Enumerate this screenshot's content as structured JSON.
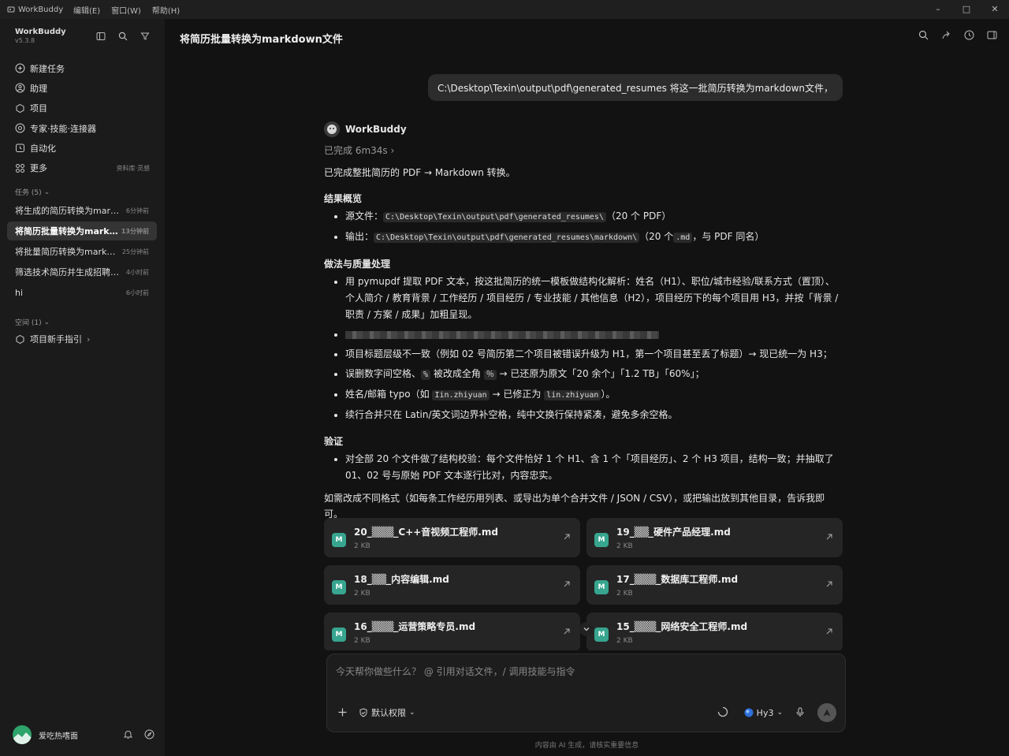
{
  "titlebar": {
    "app_name": "WorkBuddy",
    "menus": [
      "编辑(E)",
      "窗口(W)",
      "帮助(H)"
    ]
  },
  "sidebar": {
    "brand": "WorkBuddy",
    "version": "v5.3.8",
    "nav": [
      {
        "label": "新建任务",
        "icon": "new-task-icon"
      },
      {
        "label": "助理",
        "icon": "assistant-icon"
      },
      {
        "label": "项目",
        "icon": "project-icon"
      },
      {
        "label": "专家·技能·连接器",
        "icon": "expert-icon"
      },
      {
        "label": "自动化",
        "icon": "automation-icon"
      },
      {
        "label": "更多",
        "icon": "more-icon",
        "hint": "资料库·灵感"
      }
    ],
    "tasks_header": "任务 (5)",
    "tasks": [
      {
        "title": "将生成的简历转换为markdown",
        "time": "6分钟前"
      },
      {
        "title": "将简历批量转换为markdown文件",
        "time": "13分钟前",
        "active": true
      },
      {
        "title": "将批量简历转换为markdown",
        "time": "25分钟前"
      },
      {
        "title": "筛选技术简历并生成招聘报告",
        "time": "4小时前"
      },
      {
        "title": "hi",
        "time": "6小时前"
      }
    ],
    "spaces_header": "空间 (1)",
    "space_item": "项目新手指引",
    "user_name": "爱吃热嗜面"
  },
  "main": {
    "title": "将简历批量转换为markdown文件",
    "user_message": "C:\\Desktop\\Texin\\output\\pdf\\generated_resumes  将这一批简历转换为markdown文件，",
    "bot_name": "WorkBuddy",
    "done_text": "已完成 6m34s",
    "intro": "已完成整批简历的 PDF → Markdown 转换。",
    "sec1_title": "结果概览",
    "sec1_items": [
      {
        "pre": "源文件：",
        "code": "C:\\Desktop\\Texin\\output\\pdf\\generated_resumes\\",
        "post": "（20 个 PDF）"
      },
      {
        "pre": "输出：",
        "code": "C:\\Desktop\\Texin\\output\\pdf\\generated_resumes\\markdown\\",
        "post": "（20 个",
        "code2": ".md",
        "post2": "，与 PDF 同名）"
      }
    ],
    "sec2_title": "做法与质量处理",
    "sec2_item1": "用 pymupdf 提取 PDF 文本，按这批简历的统一模板做结构化解析：姓名（H1）、职位/城市经验/联系方式（置顶）、个人简介 / 教育背景 / 工作经历 / 项目经历 / 专业技能 / 其他信息（H2），项目经历下的每个项目用 H3，并按「背景 / 职责 / 方案 / 成果」加粗呈现。",
    "sec2_item3": "项目标题层级不一致（例如 02 号简历第二个项目被错误升级为 H1，第一个项目甚至丢了标题）→ 现已统一为 H3；",
    "sec2_item4_a": "误删数字间空格、",
    "sec2_item4_code1": "%",
    "sec2_item4_b": " 被改成全角 ",
    "sec2_item4_code2": "％",
    "sec2_item4_c": " → 已还原为原文「20 余个」「1.2 TB」「60%」；",
    "sec2_item5_a": "姓名/邮箱 typo（如 ",
    "sec2_item5_code1": "Iin.zhiyuan",
    "sec2_item5_b": " → 已修正为 ",
    "sec2_item5_code2": "lin.zhiyuan",
    "sec2_item5_c": "）。",
    "sec2_item6": "续行合并只在 Latin/英文词边界补空格，纯中文换行保持紧凑，避免多余空格。",
    "sec3_title": "验证",
    "sec3_item": "对全部 20 个文件做了结构校验：每个文件恰好 1 个 H1、含 1 个「项目经历」、2 个 H3 项目，结构一致；并抽取了 01、02 号与原始 PDF 文本逐行比对，内容忠实。",
    "outro": "如需改成不同格式（如每条工作经历用列表、或导出为单个合并文件 / JSON / CSV），或把输出放到其他目录，告诉我即可。",
    "files": [
      {
        "name": "20_▒▒▒_C++音视频工程师.md",
        "size": "2 KB"
      },
      {
        "name": "19_▒▒_硬件产品经理.md",
        "size": "2 KB"
      },
      {
        "name": "18_▒▒_内容编辑.md",
        "size": "2 KB"
      },
      {
        "name": "17_▒▒▒_数据库工程师.md",
        "size": "2 KB"
      },
      {
        "name": "16_▒▒▒_运营策略专员.md",
        "size": "2 KB"
      },
      {
        "name": "15_▒▒▒_网络安全工程师.md",
        "size": "2 KB"
      }
    ],
    "file_icon_letter": "M",
    "composer_placeholder": "今天帮你做些什么？ @ 引用对话文件，/ 调用技能与指令",
    "permission_label": "默认权限",
    "model_label": "Hy3",
    "disclaimer": "内容由 AI 生成，请核实重要信息"
  },
  "colors": {
    "accent_file_icon": "#37a58f",
    "avatar": "#2ea36a",
    "main_bg": "#121212",
    "sidebar_bg": "#1b1b1b"
  }
}
